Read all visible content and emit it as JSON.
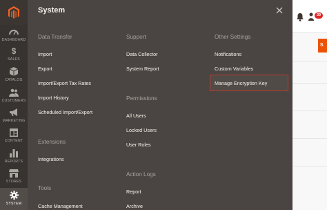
{
  "sidebar": {
    "items": [
      {
        "label": "DASHBOARD",
        "icon": "dashboard-icon"
      },
      {
        "label": "SALES",
        "icon": "dollar-icon"
      },
      {
        "label": "CATALOG",
        "icon": "box-icon"
      },
      {
        "label": "CUSTOMERS",
        "icon": "people-icon"
      },
      {
        "label": "MARKETING",
        "icon": "megaphone-icon"
      },
      {
        "label": "CONTENT",
        "icon": "layout-icon"
      },
      {
        "label": "REPORTS",
        "icon": "bar-chart-icon"
      },
      {
        "label": "STORES",
        "icon": "store-icon"
      },
      {
        "label": "SYSTEM",
        "icon": "gear-icon",
        "active": true
      }
    ]
  },
  "panel": {
    "title": "System",
    "columns": {
      "data_transfer": {
        "title": "Data Transfer",
        "links": [
          "Import",
          "Export",
          "Import/Export Tax Rates",
          "Import History",
          "Scheduled Import/Export"
        ]
      },
      "extensions": {
        "title": "Extensions",
        "links": [
          "Integrations"
        ]
      },
      "tools": {
        "title": "Tools",
        "links": [
          "Cache Management"
        ]
      },
      "support": {
        "title": "Support",
        "links": [
          "Data Collector",
          "System Report"
        ]
      },
      "permissions": {
        "title": "Permissions",
        "links": [
          "All Users",
          "Locked Users",
          "User Roles"
        ]
      },
      "action_logs": {
        "title": "Action Logs",
        "links": [
          "Report",
          "Archive"
        ]
      },
      "other_settings": {
        "title": "Other Settings",
        "links": [
          "Notifications",
          "Custom Variables",
          "Manage Encryption Key"
        ],
        "highlighted": "Manage Encryption Key"
      }
    }
  },
  "header": {
    "notification_count": "39",
    "button_label": "S"
  },
  "colors": {
    "accent": "#eb5202",
    "highlight_border": "#b83a2d",
    "panel_bg": "#4a4542",
    "sidebar_bg": "#373330"
  }
}
